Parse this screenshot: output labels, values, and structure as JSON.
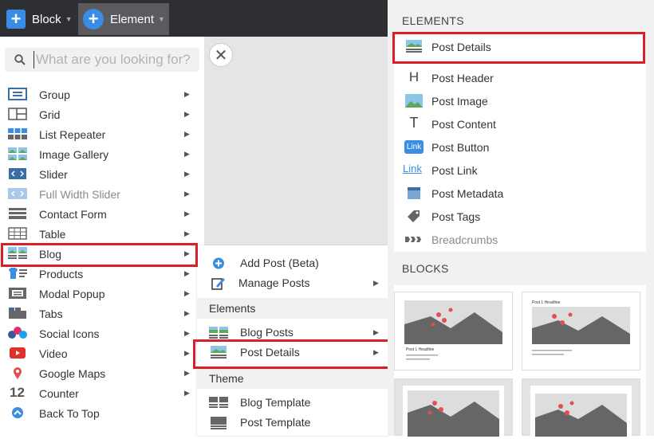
{
  "topbar": {
    "block_label": "Block",
    "element_label": "Element"
  },
  "search": {
    "placeholder": "What are you looking for?"
  },
  "left_menu": [
    {
      "label": "Group",
      "icon": "group-icon"
    },
    {
      "label": "Grid",
      "icon": "grid-icon"
    },
    {
      "label": "List Repeater",
      "icon": "list-repeater-icon"
    },
    {
      "label": "Image Gallery",
      "icon": "image-gallery-icon"
    },
    {
      "label": "Slider",
      "icon": "slider-icon"
    },
    {
      "label": "Full Width Slider",
      "icon": "full-width-slider-icon"
    },
    {
      "label": "Contact Form",
      "icon": "contact-form-icon"
    },
    {
      "label": "Table",
      "icon": "table-icon"
    },
    {
      "label": "Blog",
      "icon": "blog-icon"
    },
    {
      "label": "Products",
      "icon": "products-icon"
    },
    {
      "label": "Modal Popup",
      "icon": "modal-popup-icon"
    },
    {
      "label": "Tabs",
      "icon": "tabs-icon"
    },
    {
      "label": "Social Icons",
      "icon": "social-icons-icon"
    },
    {
      "label": "Video",
      "icon": "video-icon"
    },
    {
      "label": "Google Maps",
      "icon": "map-pin-icon"
    },
    {
      "label": "Counter",
      "icon": "counter-icon",
      "icon_text": "12"
    },
    {
      "label": "Back To Top",
      "icon": "back-to-top-icon"
    }
  ],
  "blog_submenu": {
    "items_top": [
      {
        "label": "Add Post (Beta)",
        "icon": "add-circle-icon"
      },
      {
        "label": "Manage Posts",
        "icon": "edit-icon"
      }
    ],
    "elements_heading": "Elements",
    "elements": [
      {
        "label": "Blog Posts",
        "icon": "blog-posts-icon"
      },
      {
        "label": "Post Details",
        "icon": "post-details-icon"
      }
    ],
    "theme_heading": "Theme",
    "theme": [
      {
        "label": "Blog Template",
        "icon": "blog-template-icon"
      },
      {
        "label": "Post Template",
        "icon": "post-template-icon"
      }
    ]
  },
  "right_panel": {
    "elements_heading": "ELEMENTS",
    "elements": [
      {
        "label": "Post Details",
        "icon": "post-details-icon"
      },
      {
        "label": "Post Header",
        "icon": "heading-h-icon"
      },
      {
        "label": "Post Image",
        "icon": "image-icon"
      },
      {
        "label": "Post Content",
        "icon": "text-t-icon"
      },
      {
        "label": "Post Button",
        "icon": "link-button-icon",
        "icon_text": "Link"
      },
      {
        "label": "Post Link",
        "icon": "link-text-icon",
        "icon_text": "Link"
      },
      {
        "label": "Post Metadata",
        "icon": "calendar-icon"
      },
      {
        "label": "Post Tags",
        "icon": "tag-icon"
      },
      {
        "label": "Breadcrumbs",
        "icon": "breadcrumbs-icon"
      }
    ],
    "blocks_heading": "BLOCKS",
    "blocks": [
      {
        "caption": "Post 1 Headline"
      },
      {
        "caption": "Post 1 Headline"
      },
      {
        "caption": ""
      },
      {
        "caption": ""
      }
    ]
  },
  "colors": {
    "accent_blue": "#3a8de3",
    "highlight_red": "#d9202a",
    "topbar_bg": "#2e2f33"
  }
}
